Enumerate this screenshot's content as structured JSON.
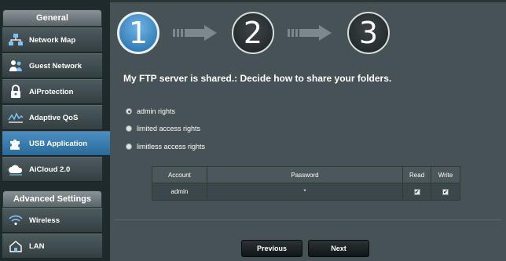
{
  "sidebar": {
    "general_header": "General",
    "items": [
      {
        "label": "Network Map",
        "icon": "network-map-icon"
      },
      {
        "label": "Guest Network",
        "icon": "guest-network-icon"
      },
      {
        "label": "AiProtection",
        "icon": "lock-icon"
      },
      {
        "label": "Adaptive QoS",
        "icon": "qos-chart-icon"
      },
      {
        "label": "USB Application",
        "icon": "puzzle-icon",
        "active": true
      },
      {
        "label": "AiCloud 2.0",
        "icon": "cloud-icon"
      }
    ],
    "advanced_header": "Advanced Settings",
    "advanced_items": [
      {
        "label": "Wireless",
        "icon": "wifi-icon"
      },
      {
        "label": "LAN",
        "icon": "home-icon"
      }
    ]
  },
  "wizard": {
    "steps": [
      "1",
      "2",
      "3"
    ],
    "active_step": 1,
    "title": "My FTP server is shared.: Decide how to share your folders.",
    "options": [
      {
        "label": "admin rights",
        "checked": true
      },
      {
        "label": "limited access rights",
        "checked": false
      },
      {
        "label": "limitless access rights",
        "checked": false
      }
    ],
    "table": {
      "headers": [
        "Account",
        "Password",
        "Read",
        "Write"
      ],
      "rows": [
        {
          "account": "admin",
          "password": "*",
          "read": true,
          "write": true
        }
      ]
    },
    "buttons": {
      "previous": "Previous",
      "next": "Next"
    }
  },
  "colors": {
    "accent": "#2f73a5",
    "background": "#465256",
    "sidebar": "#1f2a2d"
  }
}
